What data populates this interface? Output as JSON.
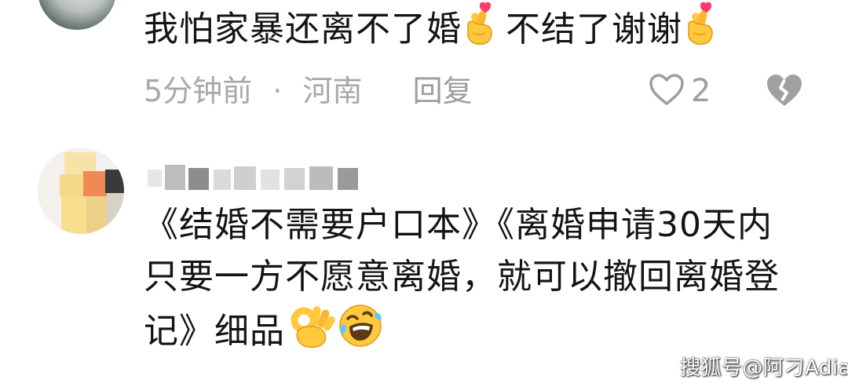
{
  "comment1": {
    "text_part1": "我怕家暴还离不了婚",
    "text_part2": "不结了谢谢",
    "emoji": "crossed-fingers-heart-emoji",
    "time": "5分钟前",
    "separator": "·",
    "location": "河南",
    "reply_label": "回复",
    "like_count": "2"
  },
  "comment2": {
    "text_main": "《结婚不需要户口本》《离婚申请30天内只要一方不愿意离婚，就可以撤回离婚登记》细品",
    "emojis": [
      "ok-hand-emoji",
      "rolling-laughing-emoji"
    ]
  },
  "watermark": "搜狐号@阿刁Adiao",
  "colors": {
    "text_primary": "#141414",
    "text_meta": "#a8a8a8",
    "background": "#ffffff"
  }
}
